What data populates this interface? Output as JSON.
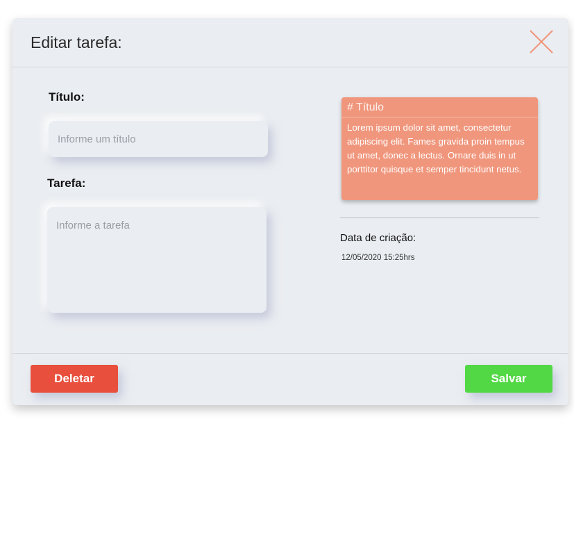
{
  "modal": {
    "title": "Editar tarefa:",
    "close_icon": "close-icon"
  },
  "form": {
    "title_label": "Título:",
    "title_placeholder": "Informe um título",
    "task_label": "Tarefa:",
    "task_placeholder": "Informe a tarefa"
  },
  "preview": {
    "title": "# Título",
    "body": "Lorem ipsum dolor sit amet, consectetur adipiscing elit. Fames gravida proin tempus ut amet, donec a lectus. Ornare duis in ut porttitor quisque et semper tincidunt netus.",
    "color": "#f0967c"
  },
  "meta": {
    "created_label": "Data de criação:",
    "created_value": "12/05/2020 15:25hrs"
  },
  "actions": {
    "delete_label": "Deletar",
    "save_label": "Salvar",
    "delete_color": "#e84f3d",
    "save_color": "#52d844"
  }
}
